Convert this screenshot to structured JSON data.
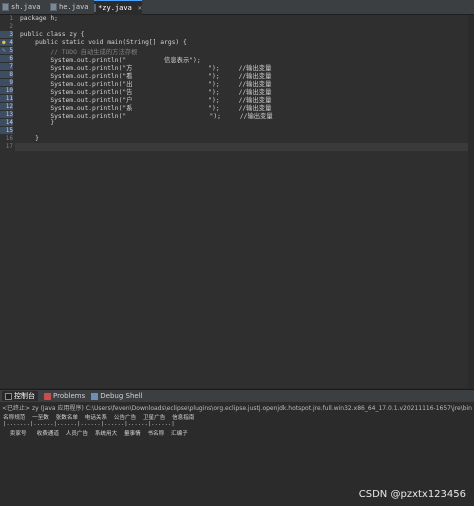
{
  "tabs": [
    {
      "label": "sh.java"
    },
    {
      "label": "he.java"
    },
    {
      "label": "*zy.java",
      "close": "✕"
    }
  ],
  "code": {
    "line_numbers": [
      "1",
      "2",
      "3",
      "4",
      "5",
      "6",
      "7",
      "8",
      "9",
      "10",
      "11",
      "12",
      "13",
      "14",
      "15",
      "16",
      "17"
    ],
    "lines": [
      "package h;",
      "",
      "public class zy {",
      "    public static void main(String[] args) {",
      "        // TODO 自动生成的方法存根",
      "        System.out.println(\"          信息表示\");",
      "        System.out.println(\"方                    \");     //输出变量",
      "        System.out.println(\"看                    \");     //输出变量",
      "        System.out.println(\"出                    \");     //输出变量",
      "        System.out.println(\"告                    \");     //输出变量",
      "        System.out.println(\"户                    \");     //输出变量",
      "        System.out.println(\"系                    \");     //输出变量",
      "        System.out.println(\"                      \");     //输出变量",
      "        }",
      "",
      "    }",
      ""
    ]
  },
  "panel": {
    "tabs": [
      {
        "label": "控制台"
      },
      {
        "label": "Problems"
      },
      {
        "label": "Debug Shell"
      }
    ],
    "console_header": "<已终止> zy (Java 应用程序) C:\\Users\\feven\\Downloads\\eclipse\\plugins\\org.eclipse.justj.openjdk.hotspot.jre.full.win32.x86_64_17.0.1.v20211116-1657\\jre\\bin",
    "output_lines": [
      "名称规范  一至数  张数名单  电话关系  公告广告  卫星广告  信息指南",
      "|.......|......|......|......|......|......|......|",
      "  卖家号   收费通道  人员广告  系统用大  量事情  书名称  汇编子"
    ]
  },
  "watermark": "CSDN @pzxtx123456"
}
